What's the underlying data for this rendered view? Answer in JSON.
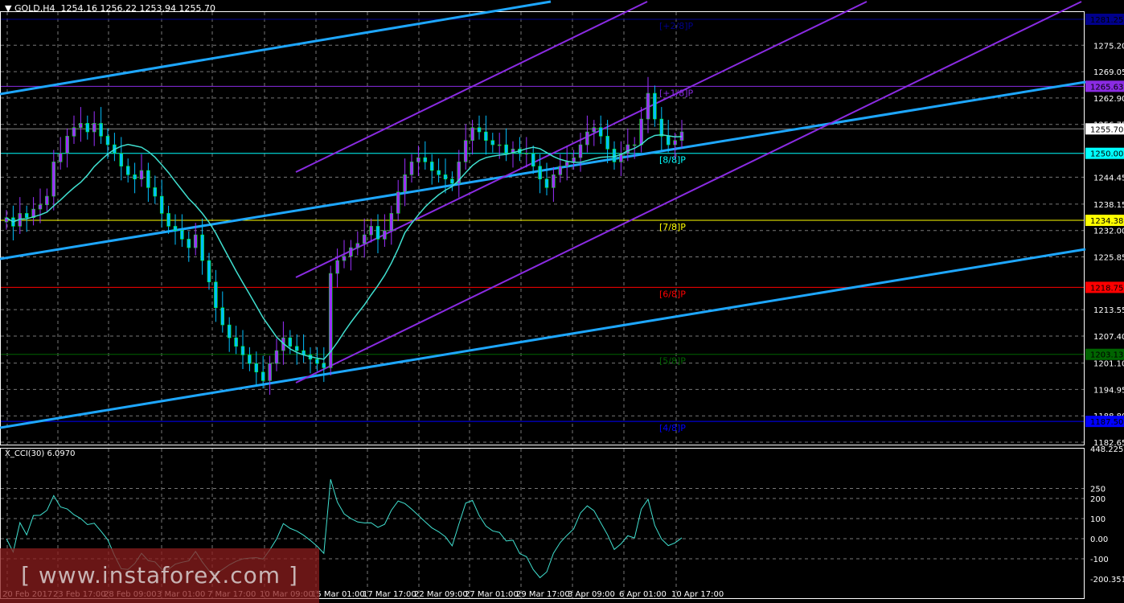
{
  "header": {
    "symbol": "GOLD,H4",
    "ohlc": "1254.16 1256.22 1253.94 1255.70"
  },
  "indicator": {
    "label": "X_CCI(30) 6.0970"
  },
  "watermark": "[ www.instaforex.com ]",
  "colors": {
    "bull": "#9b30ff",
    "bear": "#00bfff",
    "ma": "#40e0d0",
    "trend": "#1ea7ff",
    "channel": "#8a2be2"
  },
  "chart_data": {
    "type": "candlestick",
    "title": "GOLD,H4",
    "ylim": [
      1182.65,
      1281.25
    ],
    "y_ticks": [
      "1275.20",
      "1269.05",
      "1262.90",
      "1256.75",
      "1244.45",
      "1238.15",
      "1232.00",
      "1225.85",
      "1213.55",
      "1207.40",
      "1201.10",
      "1194.95",
      "1188.80",
      "1182.65"
    ],
    "x_ticks": [
      "20 Feb 2017",
      "23 Feb 17:00",
      "28 Feb 09:00",
      "3 Mar 01:00",
      "7 Mar 17:00",
      "10 Mar 09:00",
      "15 Mar 01:00",
      "17 Mar 17:00",
      "22 Mar 09:00",
      "27 Mar 01:00",
      "29 Mar 17:00",
      "3 Apr 09:00",
      "6 Apr 01:00",
      "10 Apr 17:00"
    ],
    "current_price": "1255.70",
    "levels": [
      {
        "price": "1281.25",
        "label": "[+2/8]P",
        "color": "#00008b"
      },
      {
        "price": "1265.63",
        "label": "[+1/8]P",
        "color": "#8a2be2"
      },
      {
        "price": "1250.00",
        "label": "[8/8]P",
        "color": "#00ffff"
      },
      {
        "price": "1234.38",
        "label": "[7/8]P",
        "color": "#ffff00"
      },
      {
        "price": "1218.75",
        "label": "[6/8]P",
        "color": "#ff0000"
      },
      {
        "price": "1203.13",
        "label": "[5/8]P",
        "color": "#006400"
      },
      {
        "price": "1187.50",
        "label": "[4/8]P",
        "color": "#0000ff"
      }
    ],
    "closes": [
      1235,
      1233,
      1236,
      1235,
      1237,
      1238,
      1240,
      1248,
      1250,
      1254,
      1256,
      1257,
      1255,
      1257,
      1254,
      1252,
      1250,
      1247,
      1245,
      1244,
      1246,
      1242,
      1240,
      1236,
      1233,
      1232,
      1230,
      1228,
      1231,
      1225,
      1220,
      1214,
      1210,
      1207,
      1205,
      1203,
      1201,
      1199,
      1197,
      1201,
      1204,
      1207,
      1205,
      1204,
      1203,
      1202,
      1201,
      1200,
      1222,
      1225,
      1226,
      1228,
      1229,
      1231,
      1233,
      1230,
      1232,
      1236,
      1241,
      1245,
      1248,
      1249,
      1248,
      1246,
      1245,
      1244,
      1243,
      1248,
      1253,
      1256,
      1255,
      1253,
      1252,
      1252,
      1250,
      1251,
      1250,
      1250,
      1247,
      1244,
      1242,
      1245,
      1247,
      1248,
      1249,
      1252,
      1255,
      1256,
      1254,
      1251,
      1248,
      1250,
      1252,
      1252,
      1258,
      1264,
      1258,
      1254,
      1252,
      1253,
      1255
    ],
    "cci": {
      "name": "X_CCI(30)",
      "value": "6.0970",
      "ylim": [
        -200.3518,
        448.2258
      ],
      "y_ticks": [
        "448.2258",
        "250",
        "200",
        "100",
        "0.00",
        "-100",
        "-200.3518"
      ]
    }
  }
}
